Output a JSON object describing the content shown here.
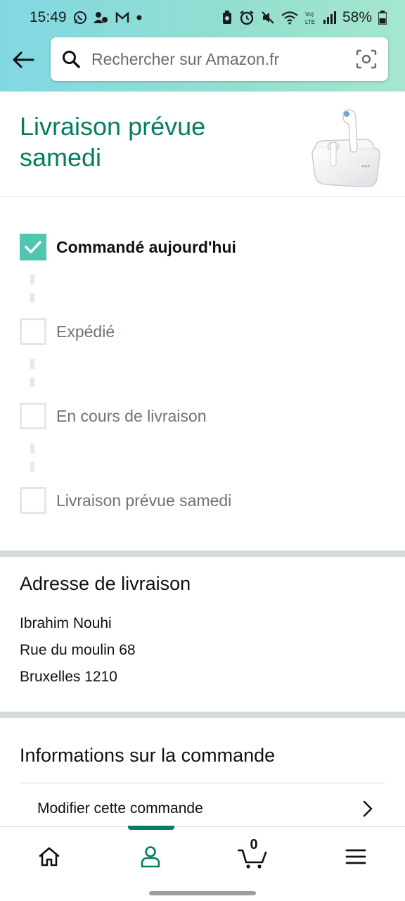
{
  "statusbar": {
    "time": "15:49",
    "battery": "58%"
  },
  "search": {
    "placeholder": "Rechercher sur Amazon.fr"
  },
  "header": {
    "title": "Livraison prévue samedi"
  },
  "tracker": {
    "steps": [
      {
        "label": "Commandé aujourd'hui",
        "done": true
      },
      {
        "label": "Expédié",
        "done": false
      },
      {
        "label": "En cours de livraison",
        "done": false
      },
      {
        "label": "Livraison prévue samedi",
        "done": false
      }
    ]
  },
  "address": {
    "heading": "Adresse de livraison",
    "name": "Ibrahim Nouhi",
    "street": "Rue du moulin 68",
    "city": "Bruxelles 1210"
  },
  "order_info": {
    "heading": "Informations sur la commande",
    "modify_label": "Modifier cette commande"
  },
  "navbar": {
    "cart_count": "0",
    "items": [
      "home-icon",
      "account-icon",
      "cart-icon",
      "menu-icon"
    ]
  },
  "colors": {
    "accent": "#067d62",
    "check": "#52c4b2",
    "top_gradient_start": "#82d8e3",
    "top_gradient_end": "#a6e6cf"
  }
}
